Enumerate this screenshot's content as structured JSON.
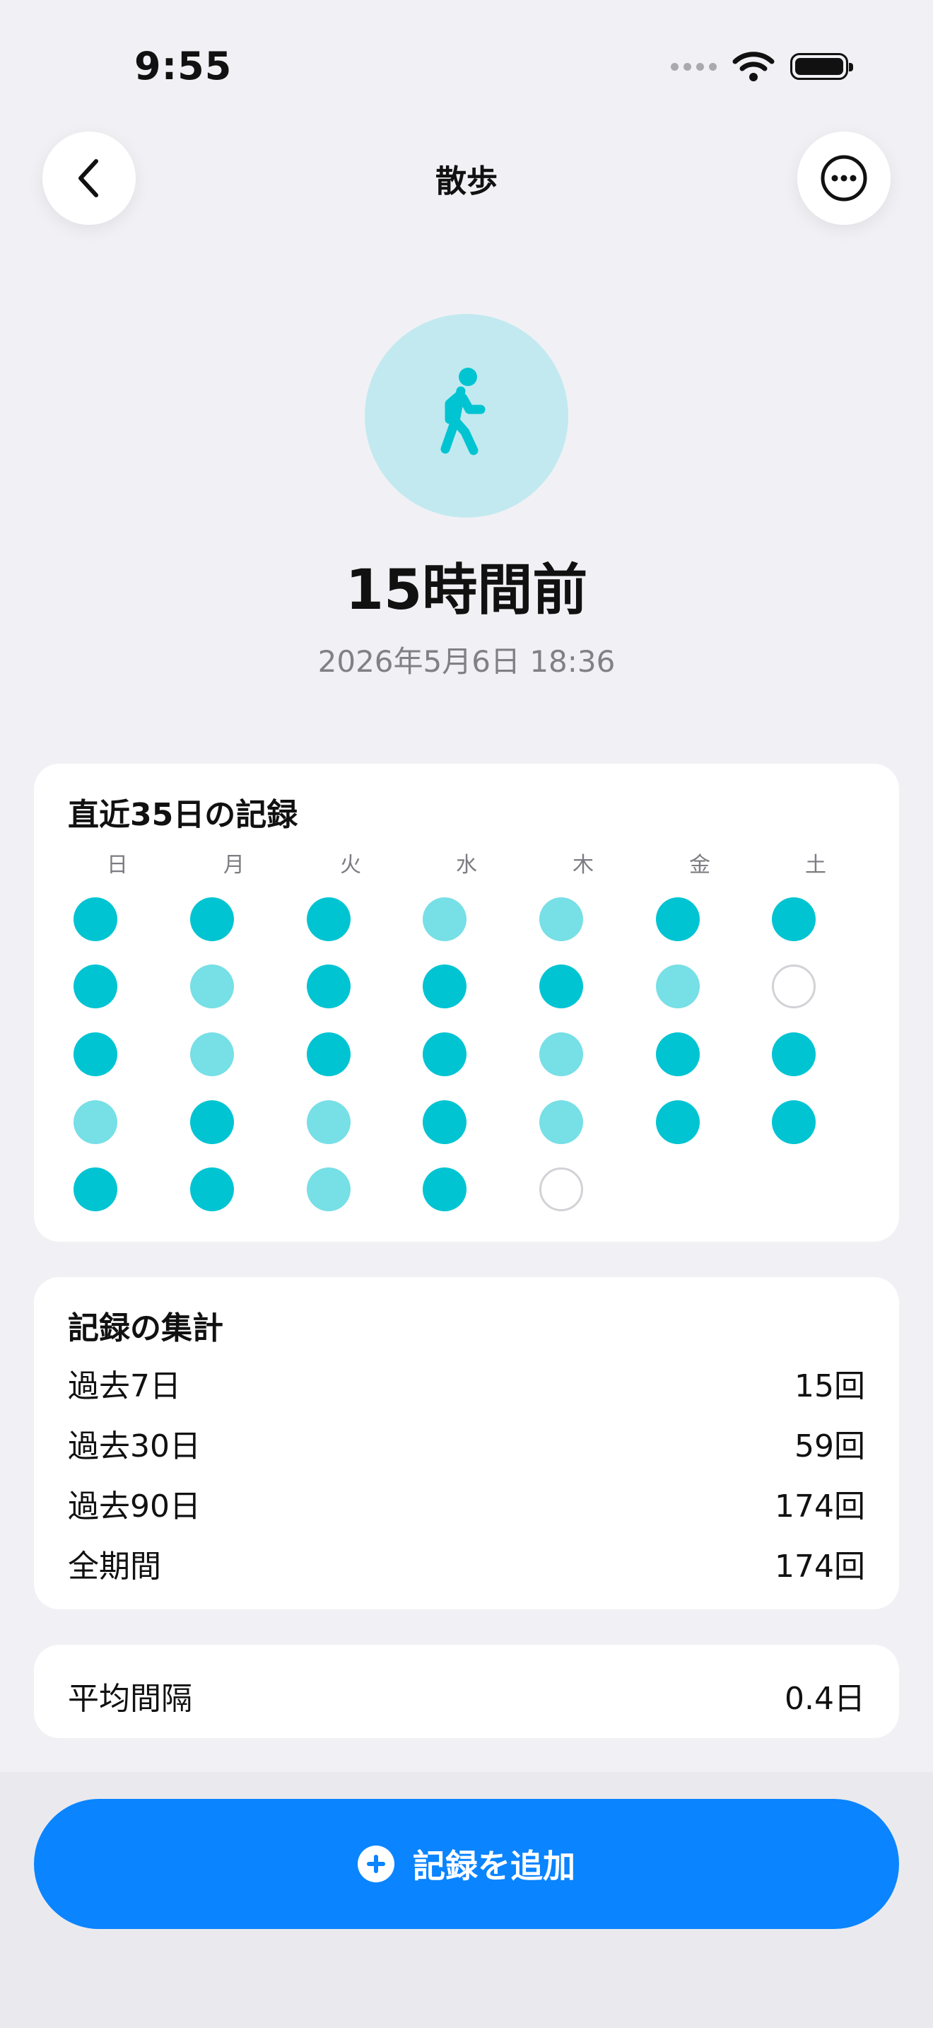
{
  "status_bar": {
    "time": "9:55"
  },
  "nav": {
    "title": "散歩"
  },
  "hero": {
    "elapsed": "15時間前",
    "datetime": "2026年5月6日 18:36",
    "icon": "walking-person-icon",
    "icon_color": "#00C4D2",
    "circle_color": "#C2E9F0"
  },
  "calendar": {
    "title": "直近35日の記録",
    "weekdays": [
      "日",
      "月",
      "火",
      "水",
      "木",
      "金",
      "土"
    ],
    "weeks": [
      [
        "full",
        "full",
        "full",
        "light",
        "light",
        "full",
        "full"
      ],
      [
        "full",
        "light",
        "full",
        "full",
        "full",
        "light",
        "empty"
      ],
      [
        "full",
        "light",
        "full",
        "full",
        "light",
        "full",
        "full"
      ],
      [
        "light",
        "full",
        "light",
        "full",
        "light",
        "full",
        "full"
      ],
      [
        "full",
        "full",
        "light",
        "full",
        "empty",
        null,
        null
      ]
    ],
    "colors": {
      "full": "#00C4D2",
      "light": "#77DFE6",
      "empty": "#FFFFFF"
    }
  },
  "summary": {
    "title": "記録の集計",
    "rows": [
      {
        "label": "過去7日",
        "value": "15回"
      },
      {
        "label": "過去30日",
        "value": "59回"
      },
      {
        "label": "過去90日",
        "value": "174回"
      },
      {
        "label": "全期間",
        "value": "174回"
      }
    ]
  },
  "interval": {
    "label": "平均間隔",
    "value": "0.4日"
  },
  "actions": {
    "add_label": "記録を追加",
    "accent": "#0A84FF"
  }
}
